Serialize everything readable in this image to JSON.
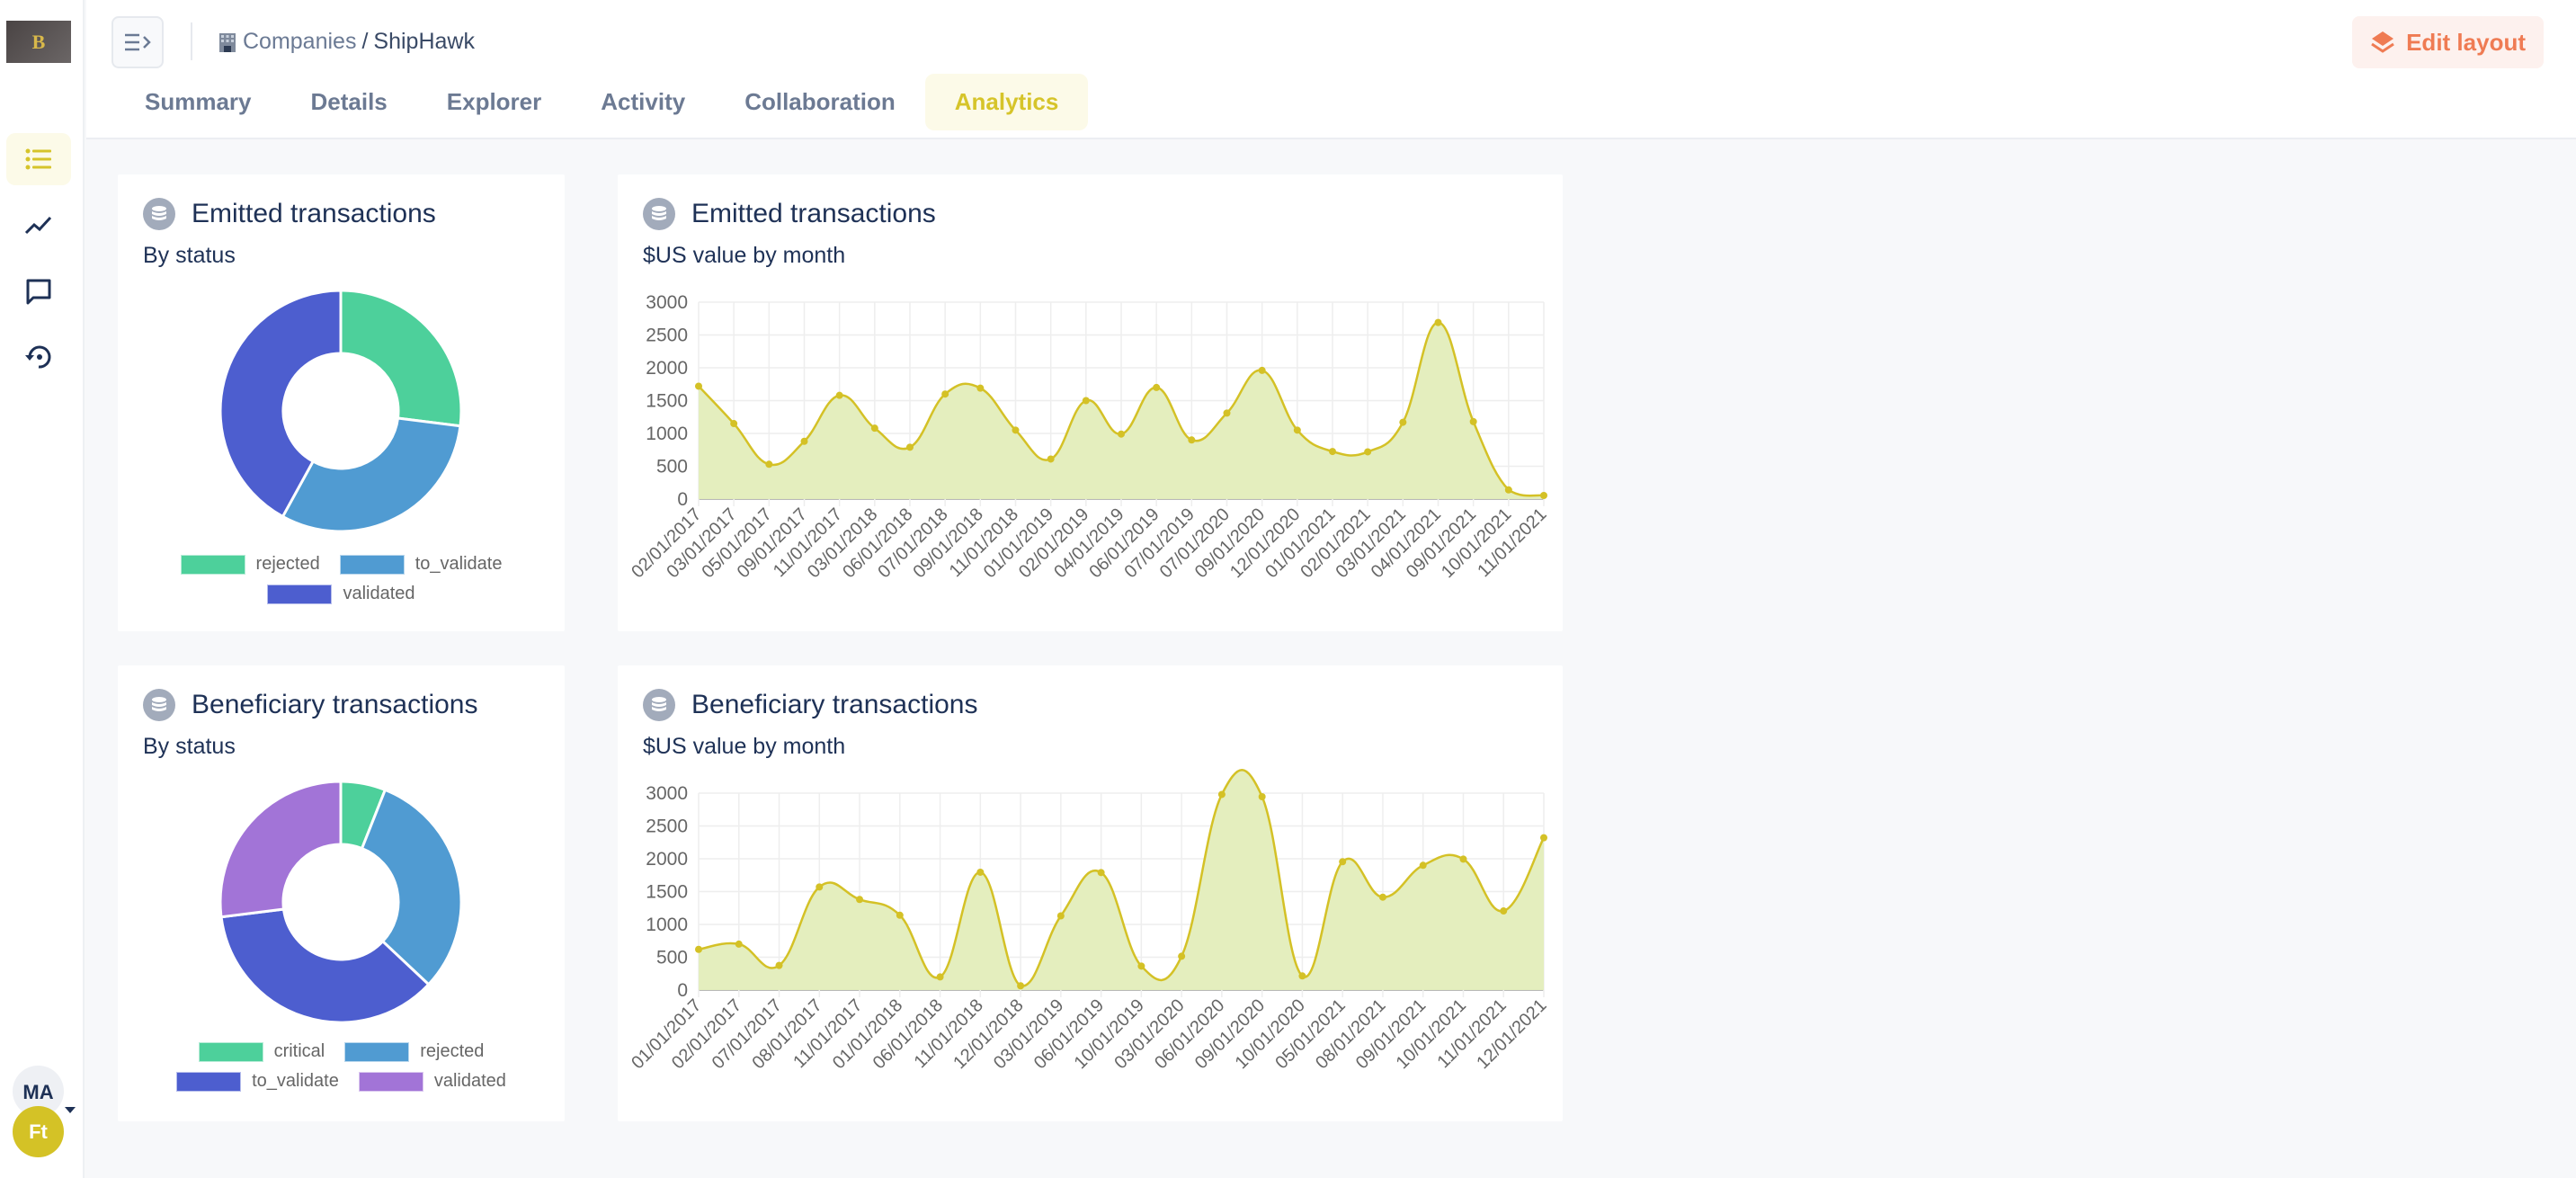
{
  "sidebar": {
    "logo_text": "B",
    "items": [
      {
        "name": "list",
        "icon": "list-icon",
        "active": true
      },
      {
        "name": "analytics",
        "icon": "trend-icon",
        "active": false
      },
      {
        "name": "comments",
        "icon": "chat-icon",
        "active": false
      },
      {
        "name": "history",
        "icon": "history-icon",
        "active": false
      }
    ],
    "user_initials": "MA",
    "org_initials": "Ft"
  },
  "header": {
    "breadcrumb": {
      "parent": "Companies",
      "separator": "/",
      "current": "ShipHawk"
    },
    "tabs": [
      {
        "label": "Summary",
        "active": false
      },
      {
        "label": "Details",
        "active": false
      },
      {
        "label": "Explorer",
        "active": false
      },
      {
        "label": "Activity",
        "active": false
      },
      {
        "label": "Collaboration",
        "active": false
      },
      {
        "label": "Analytics",
        "active": true
      }
    ],
    "edit_layout_label": "Edit layout"
  },
  "colors": {
    "accent": "#d6c42a",
    "edit_button": "#ef7b53",
    "line": "#d4c126",
    "area": "#e3edba",
    "critical": "#4dd09b",
    "rejected_emitted": "#4dd09b",
    "to_validate_emitted": "#509bd2",
    "validated_emitted": "#4d5ecf",
    "rejected_beneficiary": "#509bd2",
    "to_validate_beneficiary": "#4d5ecf",
    "validated_beneficiary": "#a274d7"
  },
  "cards": {
    "emitted_status": {
      "title": "Emitted transactions",
      "subtitle": "By status"
    },
    "emitted_monthly": {
      "title": "Emitted transactions",
      "subtitle": "$US value by month"
    },
    "beneficiary_status": {
      "title": "Beneficiary transactions",
      "subtitle": "By status"
    },
    "beneficiary_monthly": {
      "title": "Beneficiary transactions",
      "subtitle": "$US value by month"
    }
  },
  "chart_data": [
    {
      "id": "emitted_status",
      "type": "pie",
      "donut": true,
      "title": "Emitted transactions",
      "subtitle": "By status",
      "labels": [
        "rejected",
        "to_validate",
        "validated"
      ],
      "values": [
        27,
        31,
        42
      ],
      "colors": [
        "#4dd09b",
        "#509bd2",
        "#4d5ecf"
      ],
      "legend": "bottom"
    },
    {
      "id": "emitted_monthly",
      "type": "area",
      "title": "Emitted transactions",
      "subtitle": "$US value by month",
      "xlabel": "",
      "ylabel": "",
      "ylim": [
        0,
        3000
      ],
      "yticks": [
        0,
        500,
        1000,
        1500,
        2000,
        2500,
        3000
      ],
      "grid": true,
      "categories": [
        "02/01/2017",
        "03/01/2017",
        "05/01/2017",
        "09/01/2017",
        "11/01/2017",
        "03/01/2018",
        "06/01/2018",
        "07/01/2018",
        "09/01/2018",
        "11/01/2018",
        "01/01/2019",
        "02/01/2019",
        "04/01/2019",
        "06/01/2019",
        "07/01/2019",
        "07/01/2020",
        "09/01/2020",
        "12/01/2020",
        "01/01/2021",
        "02/01/2021",
        "03/01/2021",
        "04/01/2021",
        "09/01/2021",
        "10/01/2021",
        "11/01/2021"
      ],
      "values": [
        1720,
        1150,
        530,
        880,
        1580,
        1080,
        790,
        1600,
        1690,
        1050,
        610,
        1500,
        990,
        1700,
        900,
        1310,
        1960,
        1050,
        725,
        720,
        1170,
        2690,
        1180,
        140,
        55
      ]
    },
    {
      "id": "beneficiary_status",
      "type": "pie",
      "donut": true,
      "title": "Beneficiary transactions",
      "subtitle": "By status",
      "labels": [
        "critical",
        "rejected",
        "to_validate",
        "validated"
      ],
      "values": [
        6,
        31,
        36,
        27
      ],
      "colors": [
        "#4dd09b",
        "#509bd2",
        "#4d5ecf",
        "#a274d7"
      ],
      "legend": "bottom"
    },
    {
      "id": "beneficiary_monthly",
      "type": "area",
      "title": "Beneficiary transactions",
      "subtitle": "$US value by month",
      "xlabel": "",
      "ylabel": "",
      "ylim": [
        0,
        3000
      ],
      "yticks": [
        0,
        500,
        1000,
        1500,
        2000,
        2500,
        3000
      ],
      "grid": true,
      "categories": [
        "01/01/2017",
        "02/01/2017",
        "07/01/2017",
        "08/01/2017",
        "11/01/2017",
        "01/01/2018",
        "06/01/2018",
        "11/01/2018",
        "12/01/2018",
        "03/01/2019",
        "06/01/2019",
        "10/01/2019",
        "03/01/2020",
        "06/01/2020",
        "09/01/2020",
        "10/01/2020",
        "05/01/2021",
        "08/01/2021",
        "09/01/2021",
        "10/01/2021",
        "11/01/2021",
        "12/01/2021"
      ],
      "values": [
        620,
        700,
        375,
        1570,
        1380,
        1140,
        200,
        1795,
        65,
        1130,
        1790,
        365,
        515,
        2980,
        2945,
        215,
        1955,
        1415,
        1900,
        1995,
        1205,
        2320
      ]
    }
  ]
}
